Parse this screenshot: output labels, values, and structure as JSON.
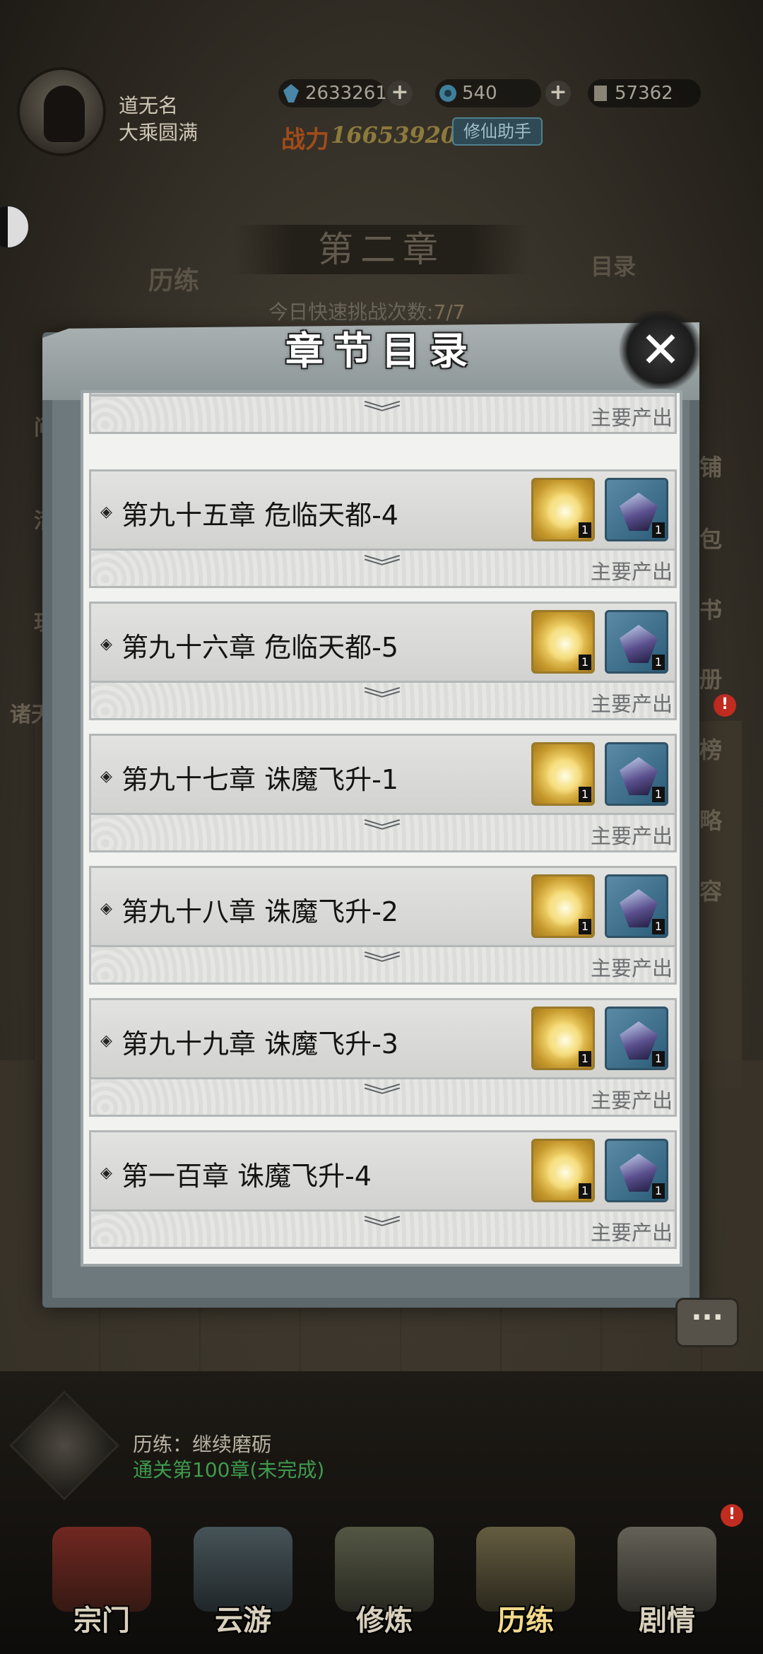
{
  "player": {
    "name": "道无名",
    "rank": "大乘圆满",
    "spirit_stones": "2633261",
    "jade": "540",
    "scrolls": "57362",
    "power_label": "战力",
    "power_value": "16653920",
    "helper_button": "修仙助手"
  },
  "stage": {
    "chapter_title": "第二章",
    "lilian_label": "历练",
    "directory_label": "目录",
    "quick_challenge_label": "今日快速挑战次数:",
    "quick_challenge_value": "7/7"
  },
  "side_left": [
    "问",
    "活",
    "玩",
    "诸天"
  ],
  "side_right": [
    "铺",
    "包",
    "书",
    "册",
    "榜",
    "略",
    "容"
  ],
  "side_right_badge": "!",
  "modal": {
    "title": "章节目录",
    "close_icon": "close-icon",
    "product_label": "主要产出",
    "chapters": [
      {
        "name": "第九十五章 危临天都-4",
        "reward_gold": "1",
        "reward_crystal": "1"
      },
      {
        "name": "第九十六章 危临天都-5",
        "reward_gold": "1",
        "reward_crystal": "1"
      },
      {
        "name": "第九十七章 诛魔飞升-1",
        "reward_gold": "1",
        "reward_crystal": "1"
      },
      {
        "name": "第九十八章 诛魔飞升-2",
        "reward_gold": "1",
        "reward_crystal": "1"
      },
      {
        "name": "第九十九章 诛魔飞升-3",
        "reward_gold": "1",
        "reward_crystal": "1"
      },
      {
        "name": "第一百章 诛魔飞升-4",
        "reward_gold": "1",
        "reward_crystal": "1"
      }
    ]
  },
  "chat_icon": "chat-bubble-icon",
  "status": {
    "line1": "历练：继续磨砺",
    "line2": "通关第100章(未完成)"
  },
  "bottom_nav": [
    "宗门",
    "云游",
    "修炼",
    "历练",
    "剧情"
  ],
  "bottom_nav_badge": "!"
}
